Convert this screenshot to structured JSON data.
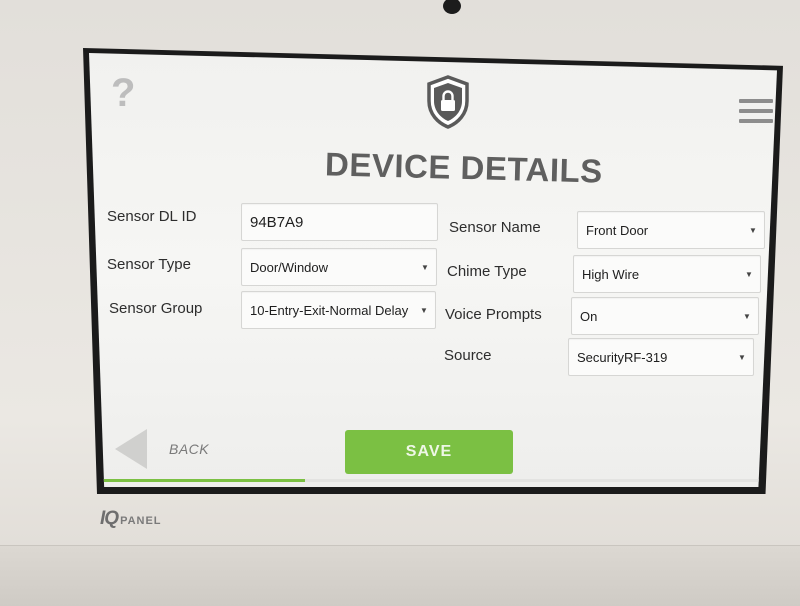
{
  "header": {
    "title": "DEVICE DETAILS"
  },
  "icons": {
    "help": "question-mark-icon",
    "security": "shield-lock-icon",
    "menu": "hamburger-menu-icon"
  },
  "help_glyph": "?",
  "fields": {
    "sensor_dl_id": {
      "label": "Sensor DL ID",
      "value": "94B7A9"
    },
    "sensor_type": {
      "label": "Sensor Type",
      "value": "Door/Window"
    },
    "sensor_group": {
      "label": "Sensor Group",
      "value": "10-Entry-Exit-Normal Delay"
    },
    "sensor_name": {
      "label": "Sensor Name",
      "value": "Front Door"
    },
    "chime_type": {
      "label": "Chime Type",
      "value": "High Wire"
    },
    "voice_prompts": {
      "label": "Voice Prompts",
      "value": "On"
    },
    "source": {
      "label": "Source",
      "value": "SecurityRF-319"
    }
  },
  "footer": {
    "back_label": "BACK",
    "save_label": "SAVE",
    "progress": 0.3
  },
  "device": {
    "logo_iq": "IQ",
    "logo_panel": "PANEL"
  },
  "colors": {
    "accent": "#7bc043",
    "title": "#5f5f5f"
  }
}
